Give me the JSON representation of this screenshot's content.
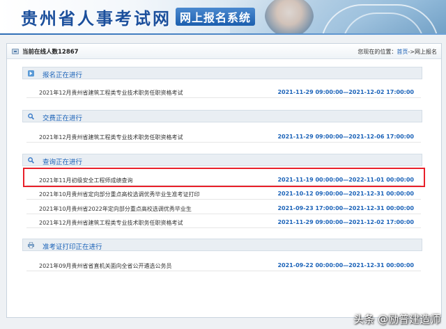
{
  "header": {
    "title": "贵州省人事考试网",
    "subtitle": "网上报名系统"
  },
  "status": {
    "online_count": "当前在线人数12867",
    "location_prefix": "您现在的位置：",
    "home_link": "首页",
    "location_suffix": "->网上报名"
  },
  "sections": [
    {
      "title": "报名正在进行",
      "icon": "arrow-right-icon",
      "items": [
        {
          "name": "2021年12月贵州省建筑工程类专业技术职务任职资格考试",
          "time": "2021-11-29 09:00:00—2021-12-02 17:00:00"
        }
      ]
    },
    {
      "title": "交费正在进行",
      "icon": "search-icon",
      "items": [
        {
          "name": "2021年12月贵州省建筑工程类专业技术职务任职资格考试",
          "time": "2021-11-29 09:00:00—2021-12-06 17:00:00"
        }
      ]
    },
    {
      "title": "查询正在进行",
      "icon": "search-icon",
      "items": [
        {
          "name": "2021年11月初级安全工程师成绩查询",
          "time": "2021-11-19 00:00:00—2022-11-01 00:00:00"
        },
        {
          "name": "2021年10月贵州省定向部分重点高校选调优秀毕业生准考证打印",
          "time": "2021-10-12 09:00:00—2021-12-31 00:00:00"
        },
        {
          "name": "2021年10月贵州省2022年定向部分重点高校选调优秀毕业生",
          "time": "2021-09-23 17:00:00—2021-12-31 00:00:00"
        },
        {
          "name": "2021年12月贵州省建筑工程类专业技术职务任职资格考试",
          "time": "2021-11-29 09:00:00—2021-12-02 17:00:00"
        }
      ]
    },
    {
      "title": "准考证打印正在进行",
      "icon": "printer-icon",
      "items": [
        {
          "name": "2021年09月贵州省省直机关面向全省公开遴选公务员",
          "time": "2021-09-22 00:00:00—2021-12-31 00:00:00"
        }
      ]
    }
  ],
  "watermark": "头条 @励普建造师",
  "colors": {
    "link_blue": "#1a62b8",
    "highlight_red": "#e8202a",
    "title_blue": "#1b4f9c"
  }
}
